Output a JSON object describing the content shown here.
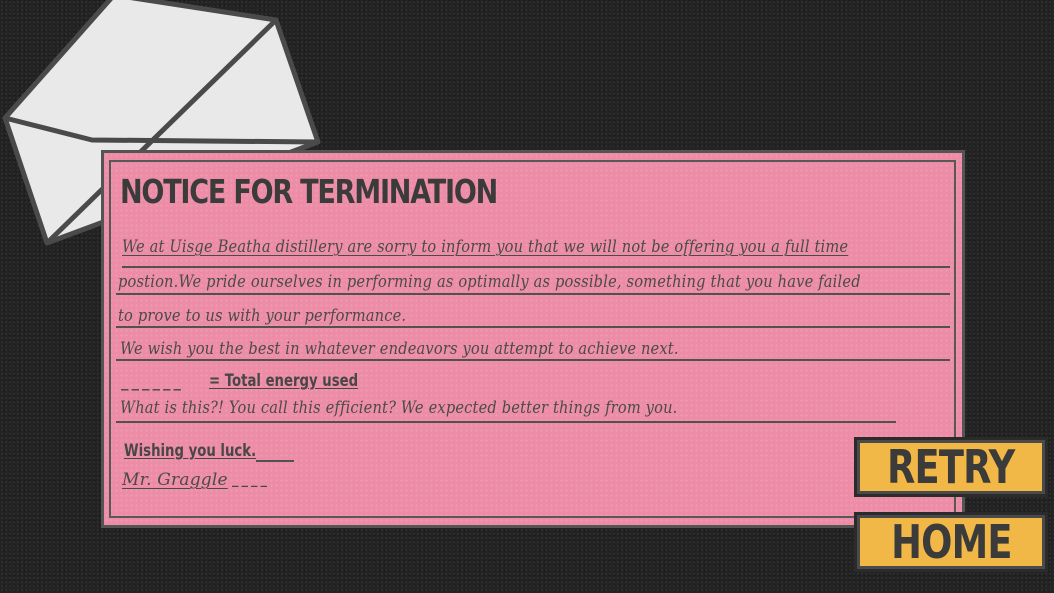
{
  "letter": {
    "title": "NOTICE FOR TERMINATION",
    "paragraph_lines": [
      "We at Uisge Beatha distillery are sorry to inform you that we will not be offering you a full time",
      "postion.We pride ourselves in performing as optimally as possible, something that you have failed",
      "to prove to us with your performance.",
      "We wish you the best in whatever endeavors you attempt to achieve next."
    ],
    "energy_blank": "______",
    "energy_label": "= Total energy used",
    "feedback": "What is this?! You call this efficient? We expected better things from you.",
    "closing": "Wishing you luck.",
    "signature": "Mr. Graggle",
    "signature_trail": "____"
  },
  "buttons": {
    "retry": "RETRY",
    "home": "HOME"
  },
  "colors": {
    "background": "#232323",
    "paper": "#ed8ca6",
    "button": "#f2b847",
    "ink": "#474747"
  }
}
